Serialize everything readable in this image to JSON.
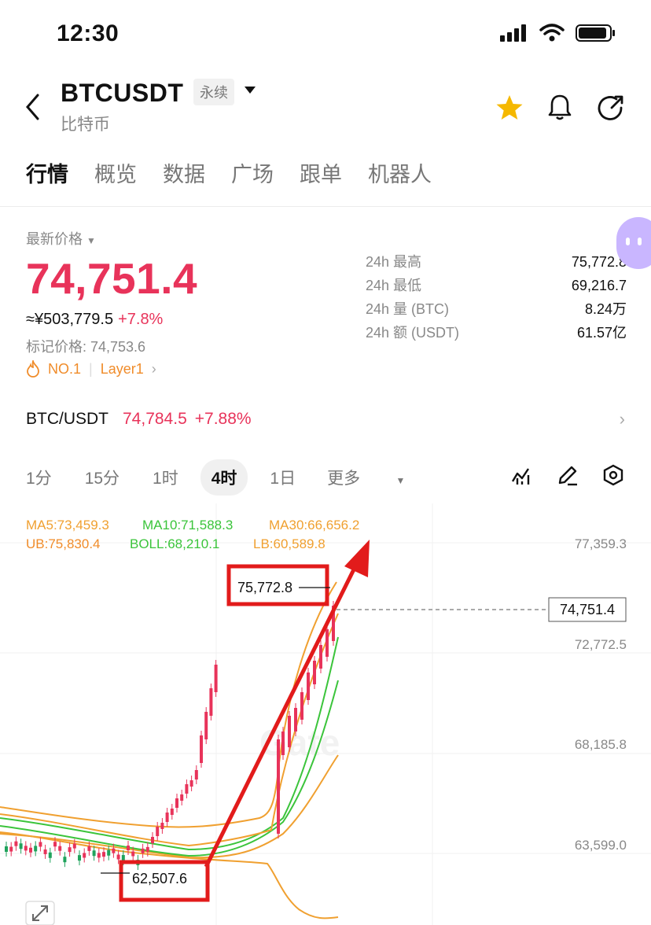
{
  "status_bar": {
    "time": "12:30"
  },
  "header": {
    "symbol": "BTCUSDT",
    "contract_badge": "永续",
    "subtitle": "比特币"
  },
  "tabs": [
    "行情",
    "概览",
    "数据",
    "广场",
    "跟单",
    "机器人"
  ],
  "price": {
    "label": "最新价格",
    "last": "74,751.4",
    "cny": "≈¥503,779.5",
    "change": "+7.8%",
    "mark_price": "标记价格: 74,753.6",
    "tag1": "NO.1",
    "tag2": "Layer1"
  },
  "stats": [
    {
      "k": "24h  最高",
      "v": "75,772.8"
    },
    {
      "k": "24h  最低",
      "v": "69,216.7"
    },
    {
      "k": "24h  量 (BTC)",
      "v": "8.24万"
    },
    {
      "k": "24h  额 (USDT)",
      "v": "61.57亿"
    }
  ],
  "spot": {
    "pair": "BTC/USDT",
    "price": "74,784.5",
    "change": "+7.88%"
  },
  "intervals": [
    "1分",
    "15分",
    "1时",
    "4时",
    "1日",
    "更多"
  ],
  "selected_interval": "4时",
  "indicators": {
    "ma5": "MA5:73,459.3",
    "ma10": "MA10:71,588.3",
    "ma30": "MA30:66,656.2",
    "ub": "UB:75,830.4",
    "boll": "BOLL:68,210.1",
    "lb": "LB:60,589.8"
  },
  "y_axis": [
    "77,359.3",
    "72,772.5",
    "68,185.8",
    "63,599.0"
  ],
  "current_price_tag": "74,751.4",
  "annotations": {
    "high": "75,772.8",
    "low": "62,507.6"
  },
  "watermark": "Gate",
  "colors": {
    "up": "#e8335a",
    "down": "#1fa35c",
    "accent": "#f5b800",
    "annotation": "#e21b1b"
  }
}
